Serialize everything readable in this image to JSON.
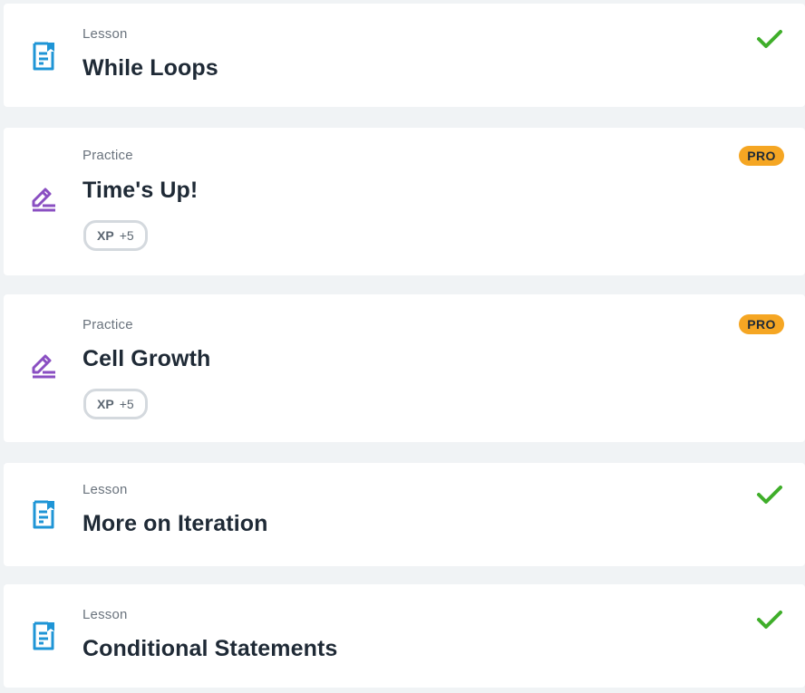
{
  "colors": {
    "lesson_icon": "#1f95d6",
    "practice_icon": "#8a4fc2",
    "check": "#3fae2a",
    "pro_badge": "#f5a623",
    "background": "#f0f3f5"
  },
  "items": [
    {
      "type": "Lesson",
      "title": "While Loops",
      "icon": "lesson-document-icon",
      "completed": true
    },
    {
      "type": "Practice",
      "title": "Time's Up!",
      "icon": "practice-pencil-icon",
      "pro_label": "PRO",
      "xp_label": "XP",
      "xp_value": "+5"
    },
    {
      "type": "Practice",
      "title": "Cell Growth",
      "icon": "practice-pencil-icon",
      "pro_label": "PRO",
      "xp_label": "XP",
      "xp_value": "+5"
    },
    {
      "type": "Lesson",
      "title": "More on Iteration",
      "icon": "lesson-document-icon",
      "completed": true
    },
    {
      "type": "Lesson",
      "title": "Conditional Statements",
      "icon": "lesson-document-icon",
      "completed": true
    }
  ]
}
